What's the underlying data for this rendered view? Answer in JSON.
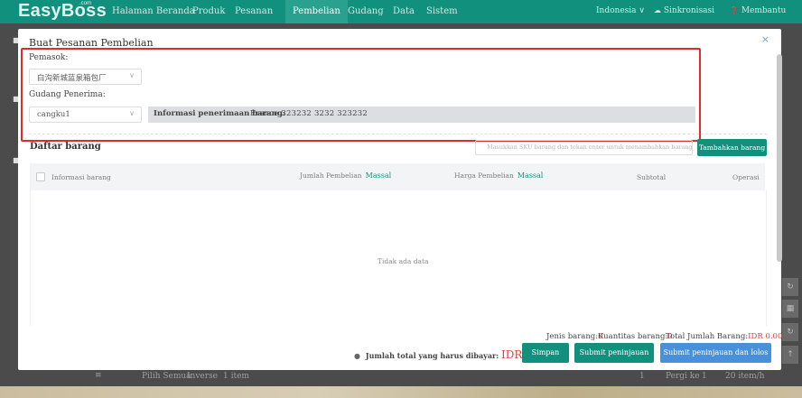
{
  "app": {
    "logo": "EasyBoss",
    "logo_suffix": ".com"
  },
  "nav": {
    "items": [
      "Halaman Beranda",
      "Produk",
      "Pesanan",
      "Pembelian",
      "Gudang",
      "Data",
      "Sistem"
    ],
    "active": "Pembelian",
    "region": "Indonesia ∨",
    "sync": "Sinkronisasi",
    "help": "Membantu"
  },
  "modal": {
    "title": "Buat Pesanan Pembelian",
    "close": "×",
    "supplier_label": "Pemasok:",
    "supplier_value": "白沟新城蓝泉箱包厂",
    "warehouse_label": "Gudang Penerima:",
    "warehouse_value": "cangku1",
    "receiving_info_label": "Informasi penerimaan barang:",
    "receiving_info_value": "France 323232    3232    323232"
  },
  "items": {
    "title": "Daftar barang",
    "search_placeholder": "Masukkan SKU barang dan tekan enter untuk menambahkan barang,gunakan",
    "add_button": "Tambahkan barang",
    "columns": {
      "info": "Informasi barang",
      "qty": "Jumlah Pembelian",
      "qty_action": "Massal",
      "price": "Harga Pembelian",
      "price_action": "Massal",
      "subtotal": "Subtotal",
      "operation": "Operasi"
    },
    "empty_text": "Tidak ada data"
  },
  "summary": {
    "item_types_label": "Jenis barang:",
    "item_types_value": "0",
    "quantity_label": "Kuantitas barang:",
    "quantity_value": "0",
    "total_qty_label": "Total Jumlah Barang:",
    "total_qty_value": "IDR 0.00"
  },
  "footer": {
    "total_label": "Jumlah total yang harus dibayar:",
    "total_value": "IDR0.00",
    "save": "Simpan",
    "submit_review": "Submit peninjauan",
    "submit_review_close": "Submit peninjauan dan lolos"
  },
  "background": {
    "select_all": "Pilih Semua",
    "inverse": "Inverse",
    "item_count": "1 item",
    "page_no": "1",
    "goto_label": "Pergi ke",
    "goto_value": "1",
    "page_size": "20 item/h"
  },
  "colors": {
    "brand": "#12907e",
    "primary_blue": "#4990db",
    "highlight_red": "#e02c2c"
  }
}
